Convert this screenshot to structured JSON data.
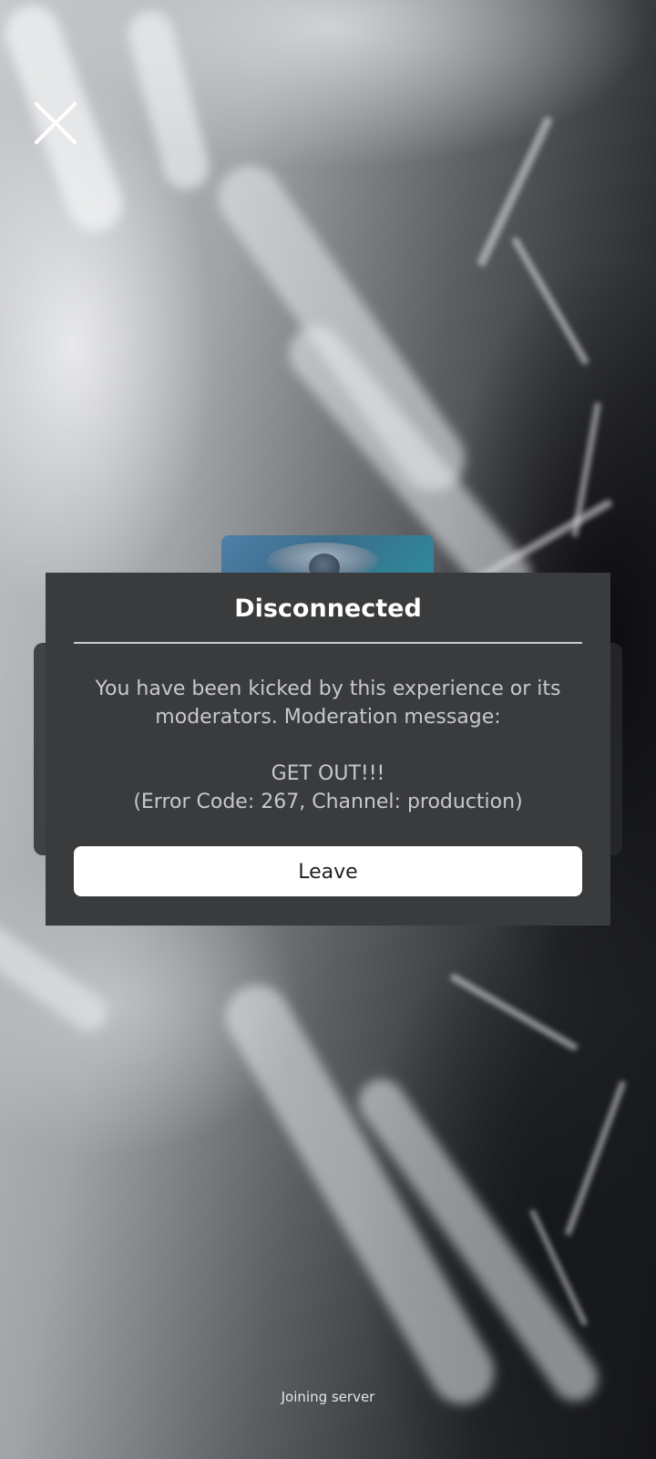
{
  "dialog": {
    "title": "Disconnected",
    "message_line1": "You have been kicked by this experience or its moderators. Moderation message:",
    "message_line2": "GET OUT!!!",
    "message_line3": "(Error Code: 267, Channel: production)",
    "leave_label": "Leave"
  },
  "status": {
    "text": "Joining server"
  },
  "icons": {
    "close": "close-icon"
  },
  "colors": {
    "dialog_bg": "#393b3d",
    "title": "#ffffff",
    "message": "#c8c9cb",
    "button_bg": "#ffffff",
    "button_text": "#1e1f21"
  }
}
